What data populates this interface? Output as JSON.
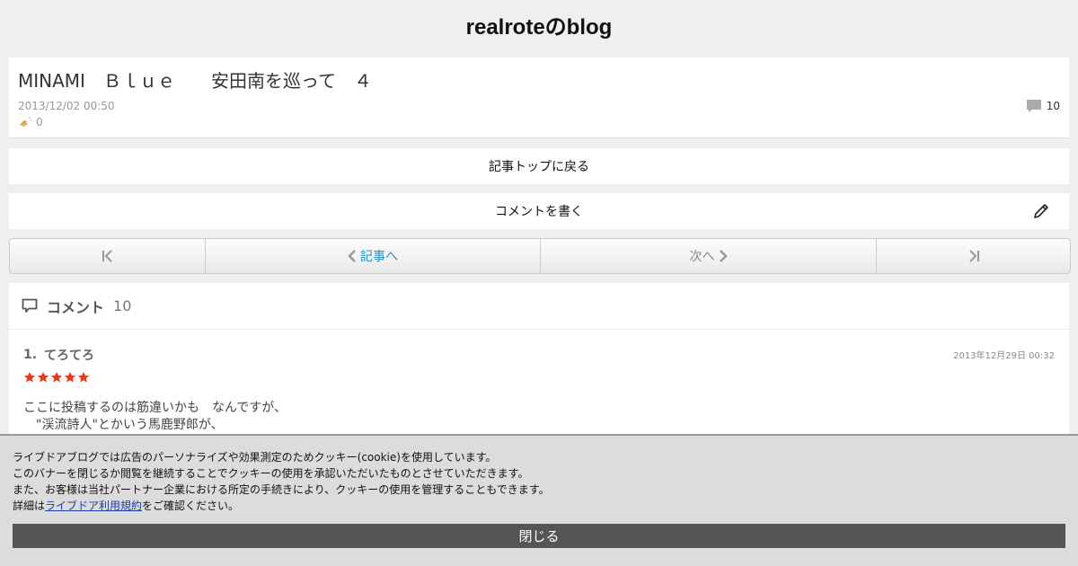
{
  "site": {
    "title": "realroteのblog"
  },
  "article": {
    "title": "MINAMI　Ｂｌｕｅ　　安田南を巡って　４",
    "date": "2013/12/02 00:50",
    "clap_count": "0",
    "comment_count": "10"
  },
  "nav": {
    "back_to_top": "記事トップに戻る",
    "write_comment": "コメントを書く"
  },
  "pager": {
    "prev_label": "記事へ",
    "next_label": "次へ"
  },
  "comments": {
    "header_label": "コメント",
    "count": "10",
    "items": [
      {
        "index": "1.",
        "author": "てろてろ",
        "date": "2013年12月29日 00:32",
        "rating": 5,
        "lines": [
          "ここに投稿するのは筋違いかも　なんですが、",
          "　\"渓流詩人\"とかいう馬鹿野郎が、"
        ]
      }
    ]
  },
  "cookie": {
    "line1": "ライブドアブログでは広告のパーソナライズや効果測定のためクッキー(cookie)を使用しています。",
    "line2": "このバナーを閉じるか閲覧を継続することでクッキーの使用を承認いただいたものとさせていただきます。",
    "line3": "また、お客様は当社パートナー企業における所定の手続きにより、クッキーの使用を管理することもできます。",
    "line4_prefix": "詳細は",
    "link_text": "ライブドア利用規約",
    "line4_suffix": "をご確認ください。",
    "close_label": "閉じる"
  },
  "colors": {
    "star": "#e8391b",
    "link": "#2a8fc7",
    "close_button": "#555555"
  }
}
